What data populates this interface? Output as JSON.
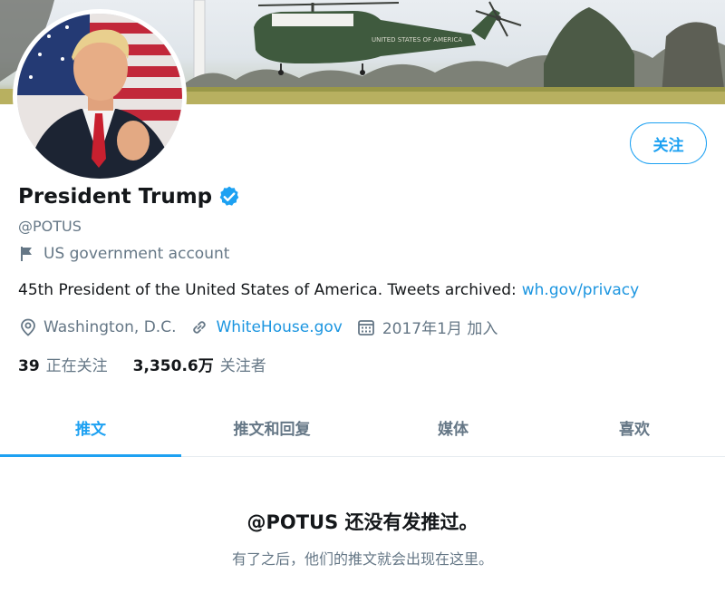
{
  "profile": {
    "name": "President Trump",
    "handle": "@POTUS",
    "verified": true,
    "account_label": "US government account",
    "bio_text": "45th President of the United States of America. Tweets archived:",
    "bio_link": "wh.gov/privacy",
    "location": "Washington, D.C.",
    "website": "WhiteHouse.gov",
    "joined": "2017年1月 加入",
    "helicopter_text": "UNITED STATES OF AMERICA"
  },
  "follow_button": {
    "label": "关注"
  },
  "stats": {
    "following_count": "39",
    "following_label": "正在关注",
    "followers_count": "3,350.6万",
    "followers_label": "关注者"
  },
  "tabs": [
    {
      "label": "推文",
      "active": true
    },
    {
      "label": "推文和回复",
      "active": false
    },
    {
      "label": "媒体",
      "active": false
    },
    {
      "label": "喜欢",
      "active": false
    }
  ],
  "empty_state": {
    "title": "@POTUS 还没有发推过。",
    "subtitle": "有了之后，他们的推文就会出现在这里。"
  },
  "colors": {
    "accent": "#1da1f2",
    "link": "#1b95e0",
    "secondary_text": "#657786",
    "primary_text": "#14171a"
  }
}
